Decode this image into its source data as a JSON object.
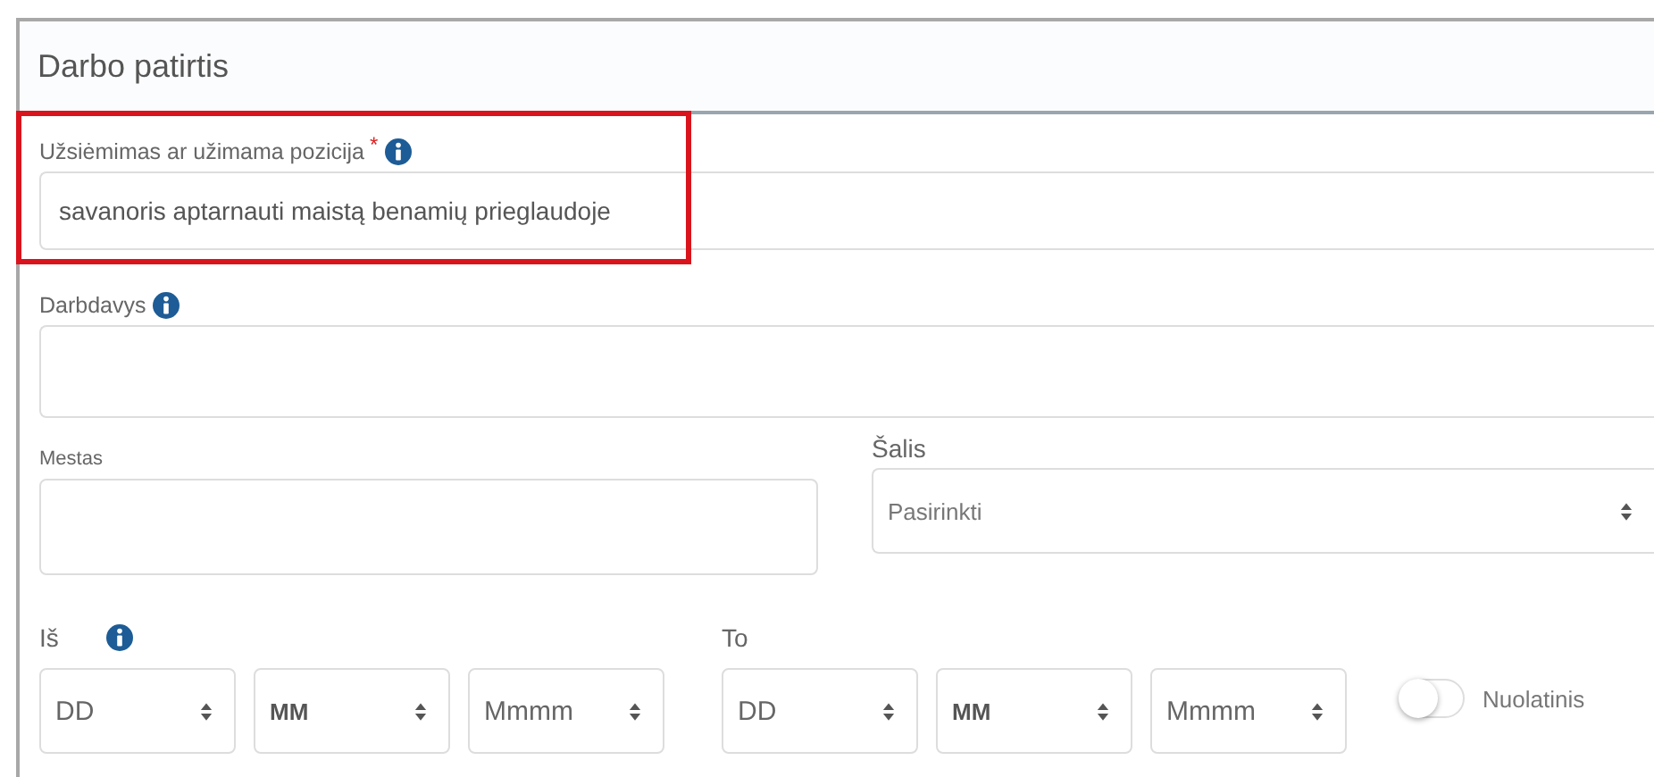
{
  "section": {
    "title": "Darbo patirtis"
  },
  "occupation": {
    "label": "Užsiėmimas ar užimama pozicija",
    "required_mark": "*",
    "value": "savanoris aptarnauti maistą benamių prieglaudoje",
    "highlighted": true
  },
  "employer": {
    "label": "Darbdavys"
  },
  "city": {
    "label": "Mestas"
  },
  "country": {
    "label": "Šalis",
    "placeholder": "Pasirinkti"
  },
  "from": {
    "label": "Iš",
    "fields": [
      {
        "placeholder": "DD",
        "bold": false
      },
      {
        "placeholder": "MM",
        "bold": true
      },
      {
        "placeholder": "Mmmm",
        "bold": false
      }
    ]
  },
  "to": {
    "label": "To",
    "fields": [
      {
        "placeholder": "DD",
        "bold": false
      },
      {
        "placeholder": "MM",
        "bold": true
      },
      {
        "placeholder": "Mmmm",
        "bold": false
      }
    ]
  },
  "ongoing": {
    "label": "Nuolatinis",
    "on": false
  }
}
